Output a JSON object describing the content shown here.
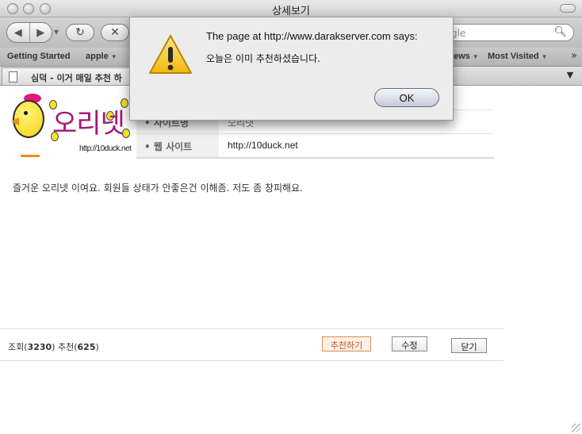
{
  "window": {
    "title": "상세보기"
  },
  "toolbar": {
    "search_placeholder": "gle"
  },
  "bookmarks": {
    "items": [
      {
        "label": "Getting Started"
      },
      {
        "label": "apple"
      }
    ],
    "right_items": [
      {
        "label": "ews"
      },
      {
        "label": "Most Visited"
      }
    ],
    "overflow": "»"
  },
  "tab": {
    "title": "심덕 - 이거 매일 추천 하"
  },
  "site": {
    "logo_url_text": "http://10duck.net",
    "logo_brand_text": "오리넷",
    "rows": [
      {
        "label": "• 사이트명",
        "value": "오리넷"
      },
      {
        "label": "• 웹 사이트",
        "value": "http://10duck.net"
      }
    ],
    "description": "즐거운 오리넷 이여요. 회원들 상태가 안좋은건 이해좀. 저도 좀 창피해요."
  },
  "footer": {
    "views_label": "조회",
    "views": "3230",
    "recommend_label": "추천",
    "recommends": "625",
    "recommend_button": "추천하기",
    "edit_button": "수정",
    "close_button": "닫기"
  },
  "dialog": {
    "title": "The page at http://www.darakserver.com says:",
    "message": "오늘은 이미 추천하셨습니다.",
    "ok_label": "OK",
    "icon": "warning-icon"
  }
}
